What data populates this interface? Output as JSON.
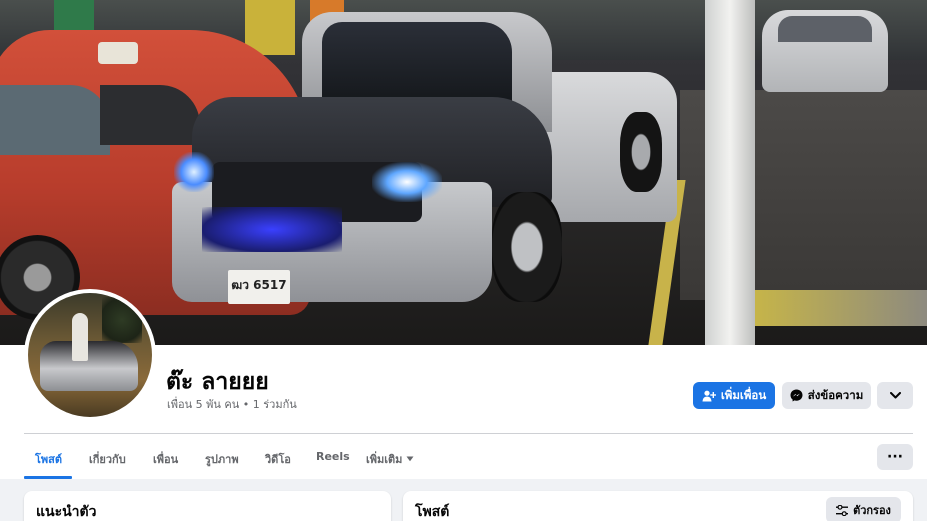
{
  "cover": {
    "plate_text": "ฒว 6517"
  },
  "profile": {
    "name": "ต๊ะ ลายยย",
    "subtitle": "เพื่อน 5 พัน คน • 1 ร่วมกัน"
  },
  "actions": {
    "add_friend_label": "เพิ่มเพื่อน",
    "message_label": "ส่งข้อความ",
    "more_icon": "chevron-down-icon"
  },
  "tabs": [
    {
      "label": "โพสต์",
      "active": true
    },
    {
      "label": "เกี่ยวกับ",
      "active": false
    },
    {
      "label": "เพื่อน",
      "active": false
    },
    {
      "label": "รูปภาพ",
      "active": false
    },
    {
      "label": "วิดีโอ",
      "active": false
    },
    {
      "label": "Reels",
      "active": false
    },
    {
      "label": "เพิ่มเติม",
      "active": false
    }
  ],
  "tab_more_dots": "···",
  "intro_card": {
    "title": "แนะนำตัว"
  },
  "posts_card": {
    "title": "โพสต์",
    "filter_label": "ตัวกรอง"
  },
  "colors": {
    "accent": "#1b74e4",
    "button_gray": "#e4e6eb",
    "secondary_text": "#65676b",
    "page_bg": "#f0f2f5"
  }
}
